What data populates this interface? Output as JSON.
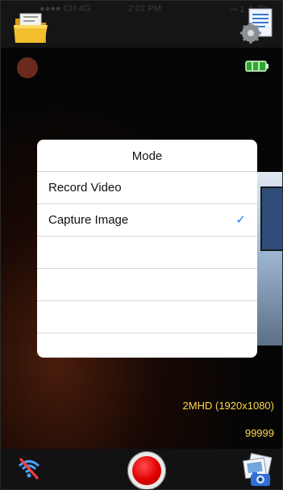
{
  "statusbar": {
    "carrier": "●●●● CH 4G",
    "time": "2:07 PM",
    "battery": "⊸ 1 ✈ 7%"
  },
  "overlay": {
    "resolution": "2MHD (1920x1080)",
    "counter": "99999"
  },
  "modal": {
    "title": "Mode",
    "options": [
      {
        "label": "Record Video",
        "selected": false
      },
      {
        "label": "Capture Image",
        "selected": true
      }
    ],
    "checkmark": "✓"
  },
  "colors": {
    "accent": "#1b7cf0",
    "overlay_text": "#ffd84a",
    "record": "#e00000"
  },
  "icons": {
    "top_left": "folder-icon",
    "top_right": "settings-icon",
    "bottom_left": "wifi-off-icon",
    "bottom_center": "record-button",
    "bottom_right": "gallery-icon"
  }
}
